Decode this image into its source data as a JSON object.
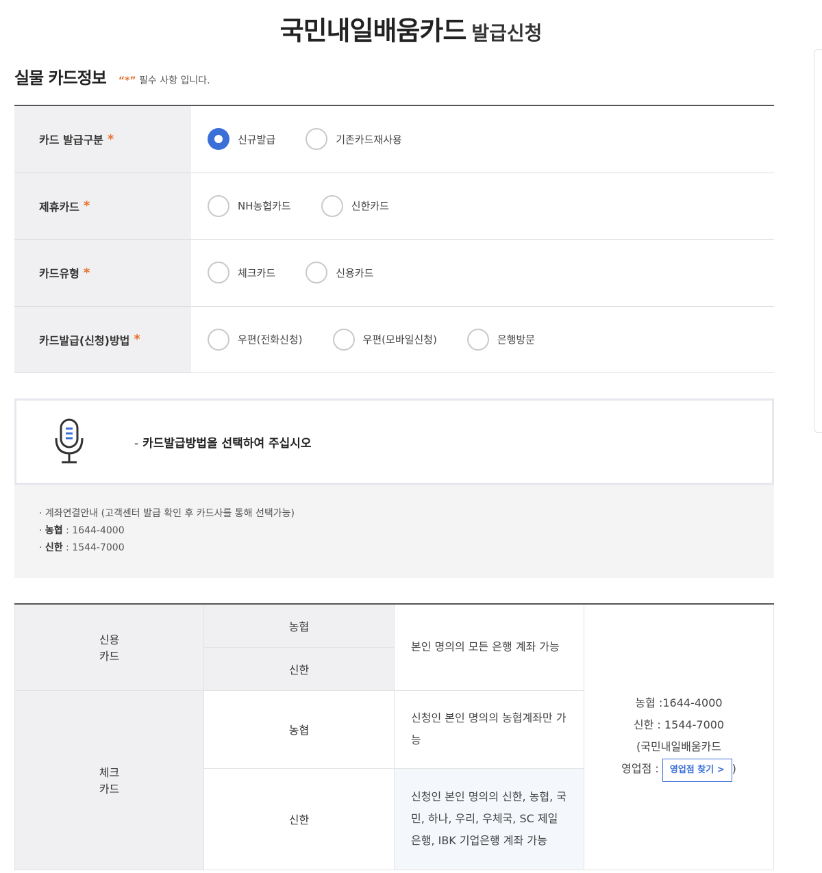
{
  "header": {
    "title": "국민내일배움카드",
    "subtitle": "발급신청"
  },
  "section": {
    "title": "실물 카드정보",
    "required_star": "“*”",
    "required_note": "필수 사항 입니다."
  },
  "form": {
    "rows": [
      {
        "label": "카드 발급구분",
        "star": "*",
        "options": [
          "신규발급",
          "기존카드재사용"
        ],
        "selected": 0
      },
      {
        "label": "제휴카드",
        "star": "*",
        "options": [
          "NH농협카드",
          "신한카드"
        ],
        "selected": -1
      },
      {
        "label": "카드유형",
        "star": "*",
        "options": [
          "체크카드",
          "신용카드"
        ],
        "selected": -1
      },
      {
        "label": "카드발급(신청)방법",
        "star": "*",
        "options": [
          "우편(전화신청)",
          "우편(모바일신청)",
          "은행방문"
        ],
        "selected": -1
      }
    ]
  },
  "voice": {
    "dash": "-",
    "message": "카드발급방법을 선택하여 주십시오",
    "icon": "microphone-icon"
  },
  "info": {
    "line1": "· 계좌연결안내 (고객센터 발급 확인 후 카드사를 통해 선택가능)",
    "line2_bullet": "· ",
    "line2_bank": "농협",
    "line2_num": " : 1644-4000",
    "line3_bullet": "· ",
    "line3_bank": "신한",
    "line3_num": " : 1544-7000"
  },
  "card_table": {
    "credit_label_1": "신용",
    "credit_label_2": "카드",
    "check_label_1": "체크",
    "check_label_2": "카드",
    "credit_nh": "농협",
    "credit_sh": "신한",
    "credit_desc": "본인 명의의 모든 은행 계좌 가능",
    "check_nh": "농협",
    "check_nh_desc": "신청인 본인 명의의 농협계좌만 가능",
    "check_sh": "신한",
    "check_sh_desc": "신청인 본인 명의의 신한, 농협, 국민, 하나, 우리, 우체국, SC 제일은행, IBK 기업은행 계좌 가능",
    "contact_nh": "농협 :1644-4000",
    "contact_sh": "신한 : 1544-7000",
    "contact_paren": "(국민내일배움카드",
    "contact_branch": "영업점 :",
    "branch_button": "영업점 찾기 >",
    "contact_close": ")"
  },
  "colors": {
    "accent": "#3a6fd8",
    "star": "#e8702a",
    "label_bg": "#f0f0f2"
  }
}
